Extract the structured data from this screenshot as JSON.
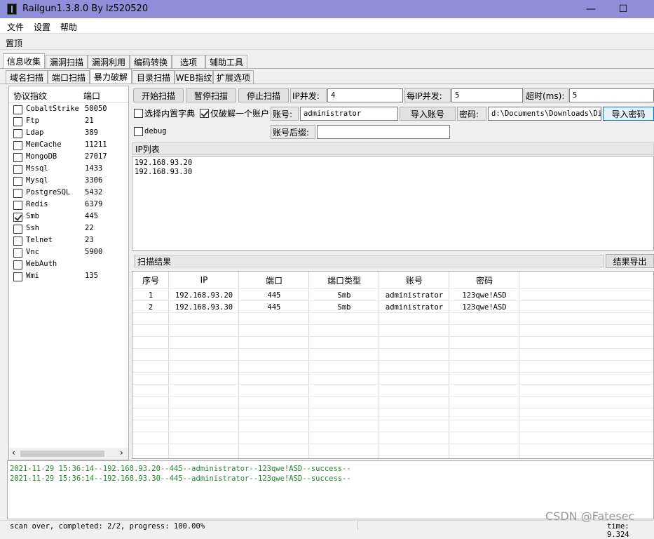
{
  "window": {
    "title": "Railgun1.3.8.0 By lz520520",
    "minimize": "—",
    "maximize": "☐"
  },
  "menu": [
    "文件",
    "设置",
    "帮助"
  ],
  "pin_label": "置顶",
  "main_tabs": [
    "信息收集",
    "漏洞扫描",
    "漏洞利用",
    "编码转换",
    "选项",
    "辅助工具"
  ],
  "sub_tabs": [
    "域名扫描",
    "端口扫描",
    "暴力破解",
    "目录扫描",
    "WEB指纹",
    "扩展选项"
  ],
  "protocol_list": {
    "headers": [
      "协议指纹",
      "端口"
    ],
    "rows": [
      {
        "name": "CobaltStrike",
        "port": "50050",
        "checked": false
      },
      {
        "name": "Ftp",
        "port": "21",
        "checked": false
      },
      {
        "name": "Ldap",
        "port": "389",
        "checked": false
      },
      {
        "name": "MemCache",
        "port": "11211",
        "checked": false
      },
      {
        "name": "MongoDB",
        "port": "27017",
        "checked": false
      },
      {
        "name": "Mssql",
        "port": "1433",
        "checked": false
      },
      {
        "name": "Mysql",
        "port": "3306",
        "checked": false
      },
      {
        "name": "PostgreSQL",
        "port": "5432",
        "checked": false
      },
      {
        "name": "Redis",
        "port": "6379",
        "checked": false
      },
      {
        "name": "Smb",
        "port": "445",
        "checked": true
      },
      {
        "name": "Ssh",
        "port": "22",
        "checked": false
      },
      {
        "name": "Telnet",
        "port": "23",
        "checked": false
      },
      {
        "name": "Vnc",
        "port": "5900",
        "checked": false
      },
      {
        "name": "WebAuth",
        "port": "",
        "checked": false
      },
      {
        "name": "Wmi",
        "port": "135",
        "checked": false
      }
    ]
  },
  "controls": {
    "start_scan": "开始扫描",
    "pause_scan": "暂停扫描",
    "stop_scan": "停止扫描",
    "ip_concurrency_label": "IP并发:",
    "ip_concurrency_value": "4",
    "per_ip_concurrency_label": "每IP并发:",
    "per_ip_concurrency_value": "5",
    "timeout_label": "超时(ms):",
    "timeout_value": "5",
    "builtin_dict_label": "选择内置字典",
    "crack_one_label": "仅破解一个账户",
    "account_label": "账号:",
    "account_value": "administrator",
    "import_account": "导入账号",
    "password_label": "密码:",
    "password_value": "d:\\Documents\\Downloads\\Dic",
    "import_password": "导入密码",
    "debug_label": "debug",
    "account_suffix_label": "账号后缀:",
    "account_suffix_value": ""
  },
  "ip_list": {
    "header": "IP列表",
    "items": [
      "192.168.93.20",
      "192.168.93.30"
    ]
  },
  "results": {
    "header": "扫描结果",
    "export_button": "结果导出",
    "columns": [
      "序号",
      "IP",
      "端口",
      "端口类型",
      "账号",
      "密码"
    ],
    "rows": [
      [
        "1",
        "192.168.93.20",
        "445",
        "Smb",
        "administrator",
        "123qwe!ASD"
      ],
      [
        "2",
        "192.168.93.30",
        "445",
        "Smb",
        "administrator",
        "123qwe!ASD"
      ]
    ]
  },
  "log": [
    "2021-11-29 15:36:14--192.168.93.20--445--administrator--123qwe!ASD--success--",
    "2021-11-29 15:36:14--192.168.93.30--445--administrator--123qwe!ASD--success--"
  ],
  "status": {
    "left": "scan over, completed: 2/2, progress: 100.00%",
    "right": "time: 9.324"
  },
  "watermark": "CSDN @Fatesec"
}
